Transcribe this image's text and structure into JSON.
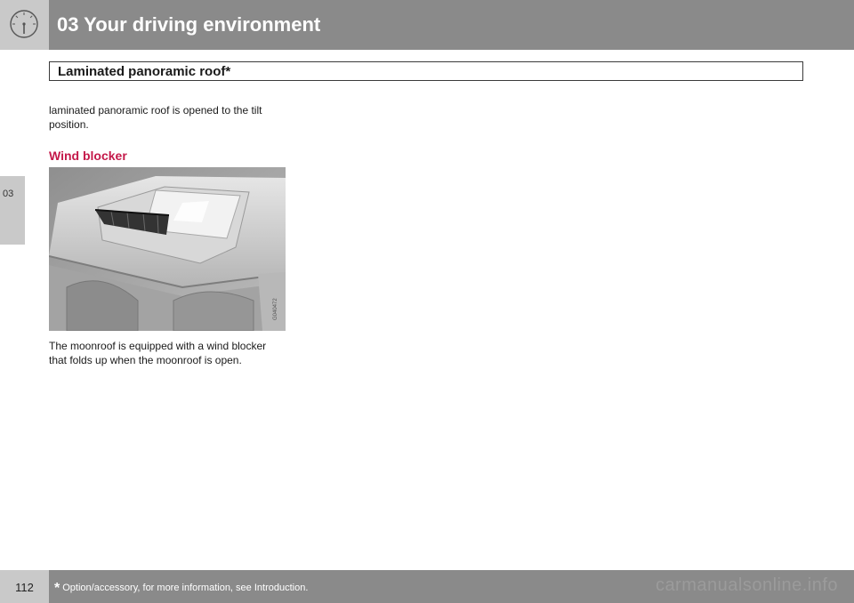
{
  "header": {
    "title": "03 Your driving environment",
    "icon": "speedometer-icon"
  },
  "section": {
    "title": "Laminated panoramic roof*"
  },
  "side_tab": {
    "label": "03"
  },
  "content": {
    "intro_line1": "laminated panoramic roof is opened to the tilt",
    "intro_line2": "position.",
    "subheading": "Wind blocker",
    "figure": {
      "code": "G040472",
      "depicts": "car-roof-wind-blocker-illustration"
    },
    "body_line1": "The moonroof is equipped with a wind blocker",
    "body_line2": "that folds up when the moonroof is open."
  },
  "footer": {
    "page_number": "112",
    "footnote_mark": "*",
    "footnote": "Option/accessory, for more information, see Introduction.",
    "watermark": "carmanualsonline.info"
  },
  "colors": {
    "header_bg": "#8a8a8a",
    "tab_bg": "#c9c9c9",
    "subheading": "#c4194a"
  }
}
